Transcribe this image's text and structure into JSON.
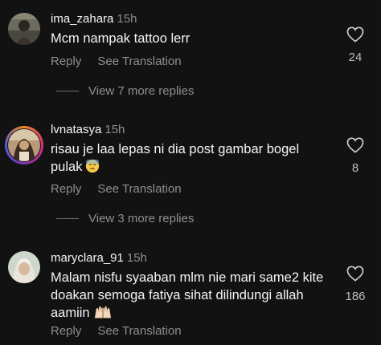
{
  "comments": [
    {
      "username": "ima_zahara",
      "time": "15h",
      "text": "Mcm nampak tattoo lerr",
      "reply_label": "Reply",
      "translate_label": "See Translation",
      "likes": "24",
      "view_more": "View 7 more replies",
      "avatar_icon": "avatar-photo-icon",
      "has_story_ring": false
    },
    {
      "username": "lvnatasya",
      "time": "15h",
      "text": "risau je laa lepas ni dia post gambar bogel pulak",
      "emoji": "😓",
      "reply_label": "Reply",
      "translate_label": "See Translation",
      "likes": "8",
      "view_more": "View 3 more replies",
      "avatar_icon": "avatar-photo-icon",
      "has_story_ring": true
    },
    {
      "username": "maryclara_91",
      "time": "15h",
      "text": "Malam nisfu syaaban mlm nie mari same2 kite doakan semoga fatiya sihat dilindungi allah aamiin",
      "emoji": "🤲🏻",
      "reply_label": "Reply",
      "translate_label": "See Translation",
      "likes": "186",
      "avatar_icon": "avatar-photo-icon",
      "has_story_ring": false
    }
  ],
  "colors": {
    "background": "#121212",
    "primary_text": "#f5f5f5",
    "secondary_text": "#8e8e8e",
    "story_ring": "#dd2a7b"
  }
}
